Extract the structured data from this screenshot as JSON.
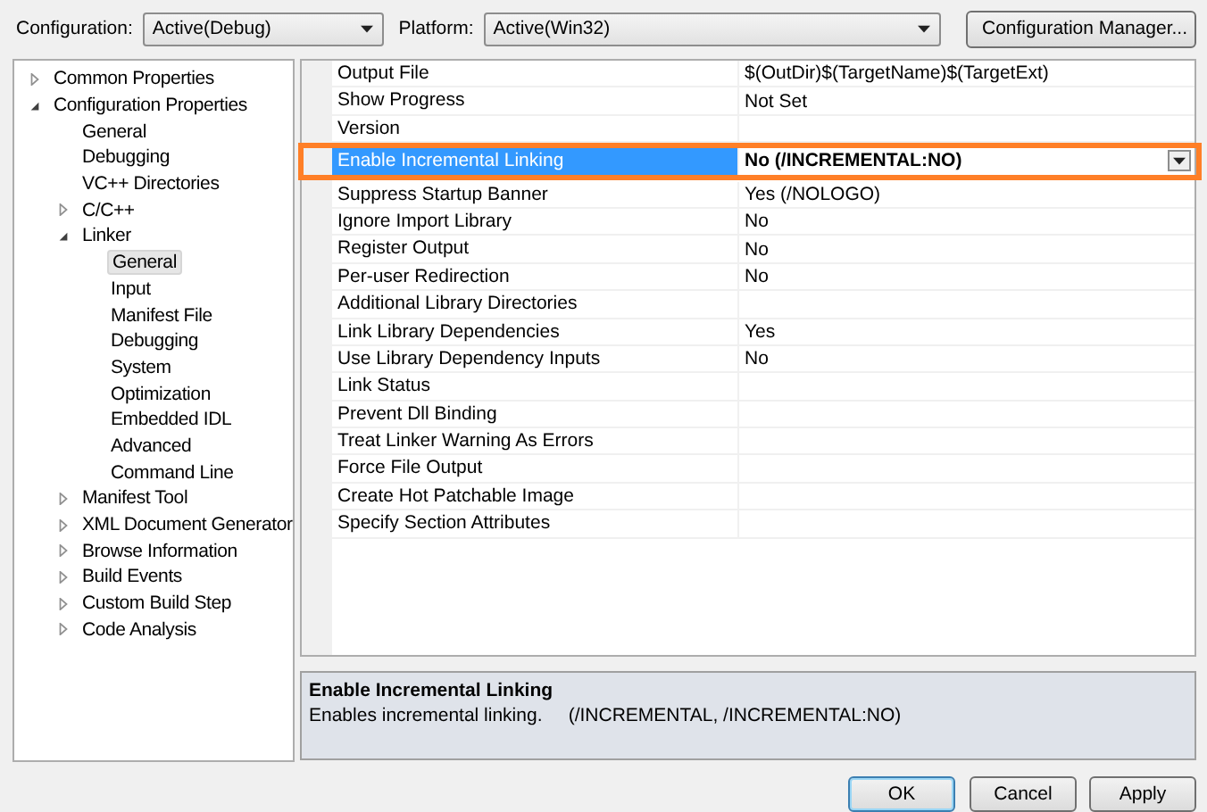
{
  "toolbar": {
    "configuration_label": "Configuration:",
    "configuration_value": "Active(Debug)",
    "platform_label": "Platform:",
    "platform_value": "Active(Win32)",
    "manager_button": "Configuration Manager..."
  },
  "tree": [
    {
      "label": "Common Properties",
      "kind": "folder",
      "expanded": false,
      "selected": false
    },
    {
      "label": "Configuration Properties",
      "kind": "folder",
      "expanded": true,
      "selected": false,
      "children": [
        {
          "label": "General",
          "kind": "leaf",
          "selected": false
        },
        {
          "label": "Debugging",
          "kind": "leaf",
          "selected": false
        },
        {
          "label": "VC++ Directories",
          "kind": "leaf",
          "selected": false
        },
        {
          "label": "C/C++",
          "kind": "folder",
          "expanded": false,
          "selected": false
        },
        {
          "label": "Linker",
          "kind": "folder",
          "expanded": true,
          "selected": false,
          "children": [
            {
              "label": "General",
              "kind": "leaf",
              "selected": true
            },
            {
              "label": "Input",
              "kind": "leaf",
              "selected": false
            },
            {
              "label": "Manifest File",
              "kind": "leaf",
              "selected": false
            },
            {
              "label": "Debugging",
              "kind": "leaf",
              "selected": false
            },
            {
              "label": "System",
              "kind": "leaf",
              "selected": false
            },
            {
              "label": "Optimization",
              "kind": "leaf",
              "selected": false
            },
            {
              "label": "Embedded IDL",
              "kind": "leaf",
              "selected": false
            },
            {
              "label": "Advanced",
              "kind": "leaf",
              "selected": false
            },
            {
              "label": "Command Line",
              "kind": "leaf",
              "selected": false
            }
          ]
        },
        {
          "label": "Manifest Tool",
          "kind": "folder",
          "expanded": false,
          "selected": false
        },
        {
          "label": "XML Document Generator",
          "kind": "folder",
          "expanded": false,
          "selected": false
        },
        {
          "label": "Browse Information",
          "kind": "folder",
          "expanded": false,
          "selected": false
        },
        {
          "label": "Build Events",
          "kind": "folder",
          "expanded": false,
          "selected": false
        },
        {
          "label": "Custom Build Step",
          "kind": "folder",
          "expanded": false,
          "selected": false
        },
        {
          "label": "Code Analysis",
          "kind": "folder",
          "expanded": false,
          "selected": false
        }
      ]
    }
  ],
  "properties": [
    {
      "name": "Output File",
      "value": "$(OutDir)$(TargetName)$(TargetExt)",
      "selected": false
    },
    {
      "name": "Show Progress",
      "value": "Not Set",
      "selected": false
    },
    {
      "name": "Version",
      "selected": false
    },
    {
      "name": "Enable Incremental Linking",
      "value": "No (/INCREMENTAL:NO)",
      "selected": true
    },
    {
      "name": "Suppress Startup Banner",
      "value": "Yes (/NOLOGO)",
      "selected": false
    },
    {
      "name": "Ignore Import Library",
      "value": "No",
      "selected": false
    },
    {
      "name": "Register Output",
      "value": "No",
      "selected": false
    },
    {
      "name": "Per-user Redirection",
      "value": "No",
      "selected": false
    },
    {
      "name": "Additional Library Directories",
      "selected": false
    },
    {
      "name": "Link Library Dependencies",
      "value": "Yes",
      "selected": false
    },
    {
      "name": "Use Library Dependency Inputs",
      "value": "No",
      "selected": false
    },
    {
      "name": "Link Status",
      "selected": false
    },
    {
      "name": "Prevent Dll Binding",
      "selected": false
    },
    {
      "name": "Treat Linker Warning As Errors",
      "selected": false
    },
    {
      "name": "Force File Output",
      "selected": false
    },
    {
      "name": "Create Hot Patchable Image",
      "selected": false
    },
    {
      "name": "Specify Section Attributes",
      "selected": false
    }
  ],
  "description": {
    "title": "Enable Incremental Linking",
    "text": "Enables incremental linking.     (/INCREMENTAL, /INCREMENTAL:NO)"
  },
  "buttons": [
    {
      "label": "OK",
      "default": true
    },
    {
      "label": "Cancel",
      "default": false
    },
    {
      "label": "Apply",
      "default": false
    }
  ]
}
